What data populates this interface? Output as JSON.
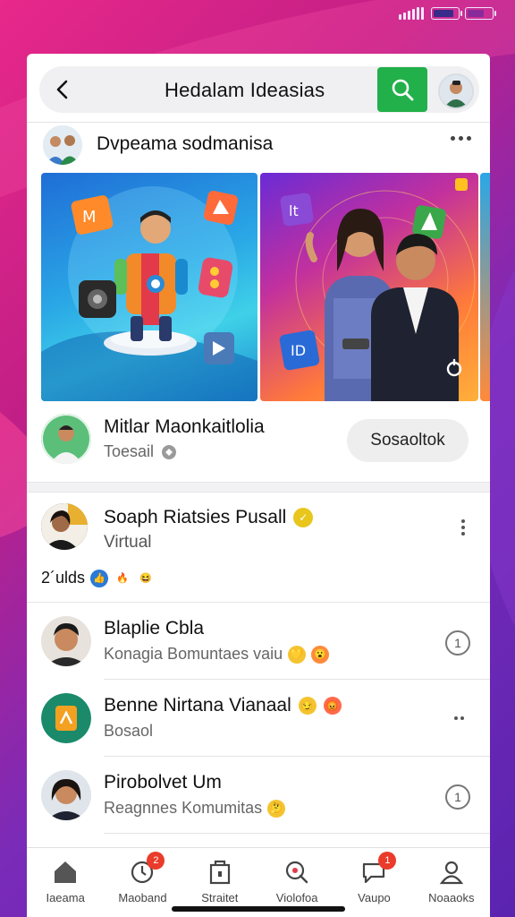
{
  "header": {
    "title": "Hedalam Ideasias",
    "back_icon": "chevron-left-icon",
    "search_icon": "search-icon",
    "search_color": "#22b04a"
  },
  "section": {
    "title": "Dvpeama sodmanisa",
    "more_icon": "more-horizontal-icon"
  },
  "featured_person": {
    "name": "Mitlar Maonkaitlolia",
    "subtitle": "Toesail",
    "action_label": "Sosaoltok"
  },
  "post": {
    "author": "Soaph Riatsies Pusall",
    "subtitle": "Virtual",
    "reactions_label": "2´ulds"
  },
  "list": [
    {
      "name": "Blaplie Cbla",
      "subtitle": "Konagia Bomuntaes vaiu",
      "trailing": "1"
    },
    {
      "name": "Benne Nirtana Vianaal",
      "subtitle": "Bosaol",
      "trailing": ""
    },
    {
      "name": "Pirobolvet Um",
      "subtitle": "Reagnnes Komumitas",
      "trailing": "1"
    }
  ],
  "nav": [
    {
      "label": "Iaeama",
      "icon": "home-icon",
      "badge": ""
    },
    {
      "label": "Maoband",
      "icon": "clock-icon",
      "badge": "2"
    },
    {
      "label": "Straitet",
      "icon": "store-icon",
      "badge": ""
    },
    {
      "label": "Violofoa",
      "icon": "search-alt-icon",
      "badge": ""
    },
    {
      "label": "Vaupo",
      "icon": "chat-icon",
      "badge": "1"
    },
    {
      "label": "Noaaoks",
      "icon": "profile-icon",
      "badge": ""
    }
  ],
  "colors": {
    "accent_green": "#22b04a",
    "badge_red": "#ea3b2b",
    "background_pink": "#e8288a",
    "background_purple": "#5a24b0"
  }
}
